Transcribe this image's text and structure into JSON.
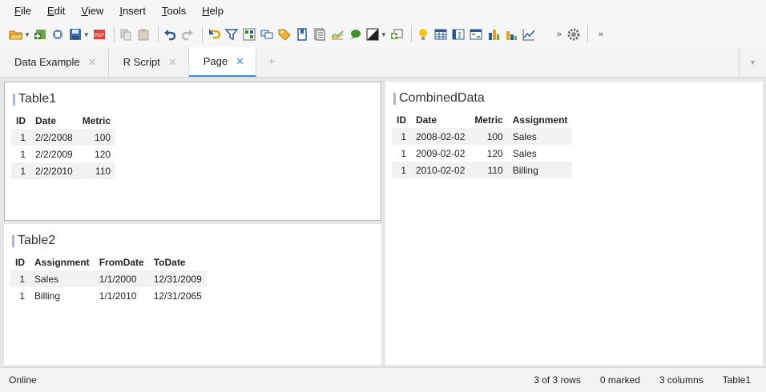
{
  "menu": {
    "items": [
      {
        "u": "F",
        "rest": "ile"
      },
      {
        "u": "E",
        "rest": "dit"
      },
      {
        "u": "V",
        "rest": "iew"
      },
      {
        "u": "I",
        "rest": "nsert"
      },
      {
        "u": "T",
        "rest": "ools"
      },
      {
        "u": "H",
        "rest": "elp"
      }
    ]
  },
  "tabs": [
    {
      "label": "Data Example",
      "active": false
    },
    {
      "label": "R Script",
      "active": false
    },
    {
      "label": "Page",
      "active": true
    }
  ],
  "tab_close": "✕",
  "tab_add": "+",
  "table1": {
    "title": "Table1",
    "columns": [
      "ID",
      "Date",
      "Metric"
    ],
    "rows": [
      [
        "1",
        "2/2/2008",
        "100"
      ],
      [
        "1",
        "2/2/2009",
        "120"
      ],
      [
        "1",
        "2/2/2010",
        "110"
      ]
    ]
  },
  "table2": {
    "title": "Table2",
    "columns": [
      "ID",
      "Assignment",
      "FromDate",
      "ToDate"
    ],
    "rows": [
      [
        "1",
        "Sales",
        "1/1/2000",
        "12/31/2009"
      ],
      [
        "1",
        "Billing",
        "1/1/2010",
        "12/31/2065"
      ]
    ]
  },
  "combined": {
    "title": "CombinedData",
    "columns": [
      "ID",
      "Date",
      "Metric",
      "Assignment"
    ],
    "rows": [
      [
        "1",
        "2008-02-02",
        "100",
        "Sales"
      ],
      [
        "1",
        "2009-02-02",
        "120",
        "Sales"
      ],
      [
        "1",
        "2010-02-02",
        "110",
        "Billing"
      ]
    ]
  },
  "status": {
    "connection": "Online",
    "rows": "3 of 3 rows",
    "marked": "0 marked",
    "columns": "3 columns",
    "active_table": "Table1"
  },
  "colors": {
    "accent": "#3b8fd4",
    "stripe": "#f2f2f2",
    "panel_bg": "#e6e6e6"
  }
}
